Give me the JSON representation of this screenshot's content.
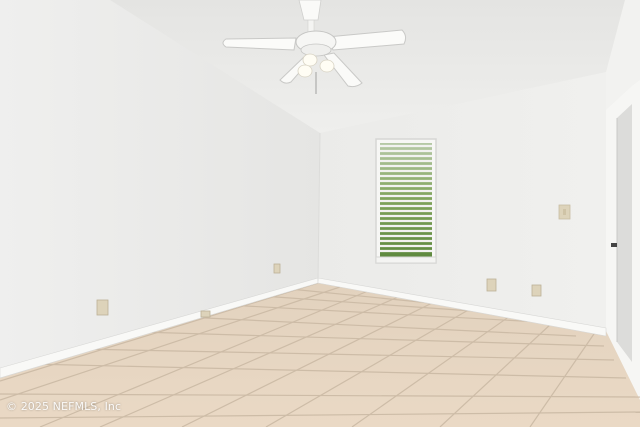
{
  "photo": {
    "watermark": "© 2025 NEFMLS, Inc"
  },
  "colors": {
    "ceiling": "#ececea",
    "left_wall": "#ececeb",
    "back_wall": "#eeeeec",
    "right_wall": "#f1f1ef",
    "floor_tile": "#e6d6c2",
    "grout": "#cdbca7",
    "baseboard": "#f8f8f6",
    "window_greenery": "#7fa35a",
    "outlet": "#d9cfb6"
  },
  "icons": {
    "ceiling_fan": "ceiling-fan-icon",
    "window": "window-blinds-icon",
    "light_switch": "light-switch-icon",
    "outlet": "power-outlet-icon"
  }
}
